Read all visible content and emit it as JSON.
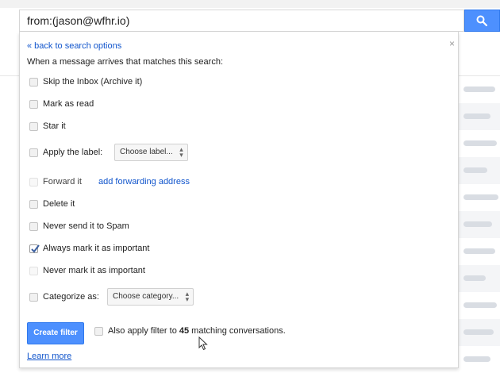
{
  "search": {
    "query": "from:(jason@wfhr.io)"
  },
  "panel": {
    "back_link": "« back to search options",
    "close": "×",
    "intro": "When a message arrives that matches this search:",
    "options": [
      {
        "label": "Skip the Inbox (Archive it)",
        "checked": false
      },
      {
        "label": "Mark as read",
        "checked": false
      },
      {
        "label": "Star it",
        "checked": false
      },
      {
        "label": "Apply the label:",
        "checked": false
      },
      {
        "label": "Forward it",
        "checked": false,
        "disabled": true
      },
      {
        "label": "Delete it",
        "checked": false
      },
      {
        "label": "Never send it to Spam",
        "checked": false
      },
      {
        "label": "Always mark it as important",
        "checked": true
      },
      {
        "label": "Never mark it as important",
        "checked": false,
        "disabled": true
      },
      {
        "label": "Categorize as:",
        "checked": false
      }
    ],
    "label_select": "Choose label...",
    "forward_link": "add forwarding address",
    "category_select": "Choose category...",
    "create_button": "Create filter",
    "also_apply": {
      "prefix": "Also apply filter to ",
      "count": "45",
      "suffix": " matching conversations."
    },
    "learn_more": "Learn more"
  },
  "colors": {
    "accent": "#4d90fe",
    "link": "#1155cc"
  }
}
